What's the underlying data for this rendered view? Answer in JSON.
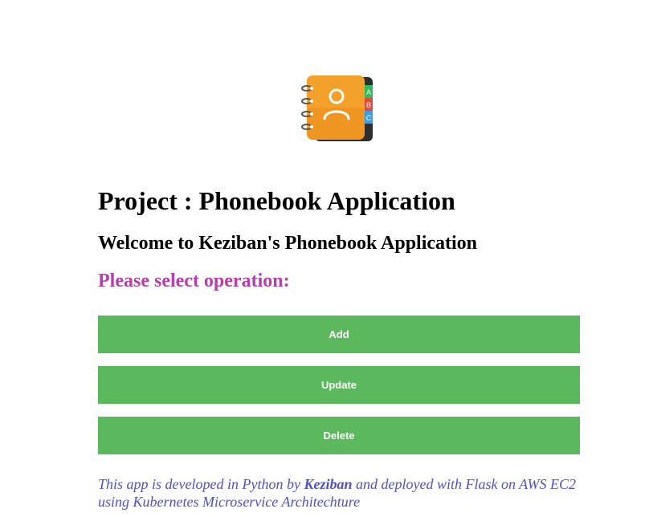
{
  "app": {
    "logo_icon": "phonebook-contact-book-icon",
    "logo_tabs": [
      "A",
      "B",
      "C"
    ]
  },
  "header": {
    "title": "Project : Phonebook Application",
    "welcome": "Welcome to Keziban's Phonebook Application",
    "prompt": "Please select operation:"
  },
  "operations": {
    "add_label": "Add",
    "update_label": "Update",
    "delete_label": "Delete"
  },
  "footer": {
    "text_before": "This app is developed in Python by ",
    "author": "Keziban",
    "text_after": " and deployed with Flask on AWS EC2 using Kubernetes Microservice Architechture"
  },
  "colors": {
    "button_bg": "#5cb85c",
    "prompt": "#b83ea8",
    "footer_text": "#4f4fcf",
    "logo_orange": "#f4a12b",
    "logo_spine": "#2e2e2e"
  }
}
